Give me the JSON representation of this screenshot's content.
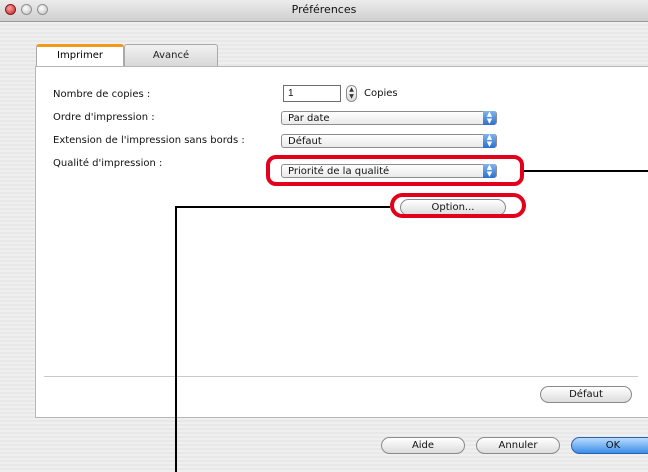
{
  "window": {
    "title": "Préférences"
  },
  "tabs": [
    {
      "label": "Imprimer",
      "active": true
    },
    {
      "label": "Avancé",
      "active": false
    }
  ],
  "fields": {
    "copies": {
      "label": "Nombre de copies :",
      "value": "1",
      "unit": "Copies"
    },
    "order": {
      "label": "Ordre d'impression :",
      "value": "Par date"
    },
    "borderless": {
      "label": "Extension de l'impression sans bords :",
      "value": "Défaut"
    },
    "quality": {
      "label": "Qualité d'impression :",
      "value": "Priorité de la qualité"
    }
  },
  "buttons": {
    "option": "Option...",
    "default": "Défaut",
    "help": "Aide",
    "cancel": "Annuler",
    "ok": "OK"
  },
  "annotations": {
    "highlight_color": "#e3001b"
  }
}
